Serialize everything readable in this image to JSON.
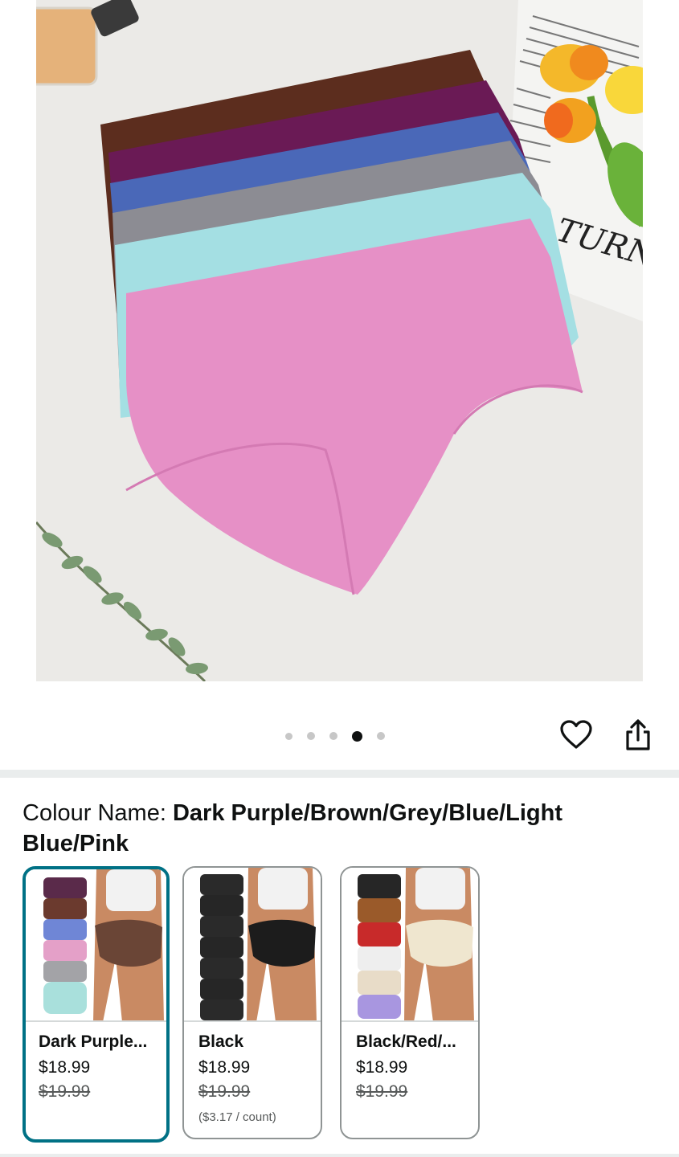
{
  "gallery": {
    "dots_total": 5,
    "active_dot": 4,
    "newspaper_text": "TURNS"
  },
  "actions": {
    "heart_icon": "heart-outline-icon",
    "share_icon": "share-icon"
  },
  "colour": {
    "label": "Colour Name: ",
    "value": "Dark Purple/Brown/Grey/Blue/Light Blue/Pink"
  },
  "variants": [
    {
      "name": "Dark Purple...",
      "price": "$18.99",
      "old_price": "$19.99",
      "unit_price": "",
      "selected": true,
      "stack_colors": [
        "#5a2a4a",
        "#6b3a2e",
        "#6f86d6",
        "#e4a0c8",
        "#a3a3a7",
        "#a9e0dc"
      ],
      "model_color": "#6a4536"
    },
    {
      "name": "Black",
      "price": "$18.99",
      "old_price": "$19.99",
      "unit_price": "($3.17 / count)",
      "selected": false,
      "stack_colors": [
        "#262626",
        "#262626",
        "#262626",
        "#262626",
        "#262626",
        "#262626"
      ],
      "model_color": "#1c1c1c"
    },
    {
      "name": "Black/Red/...",
      "price": "$18.99",
      "old_price": "$19.99",
      "unit_price": "",
      "selected": false,
      "stack_colors": [
        "#262626",
        "#9a5a2a",
        "#c82a2a",
        "#eeeeee",
        "#e8dcc8",
        "#a896e0"
      ],
      "model_color": "#efe6cf"
    }
  ],
  "colors": {
    "accent": "#007185",
    "text": "#0f1111",
    "muted": "#565959"
  }
}
